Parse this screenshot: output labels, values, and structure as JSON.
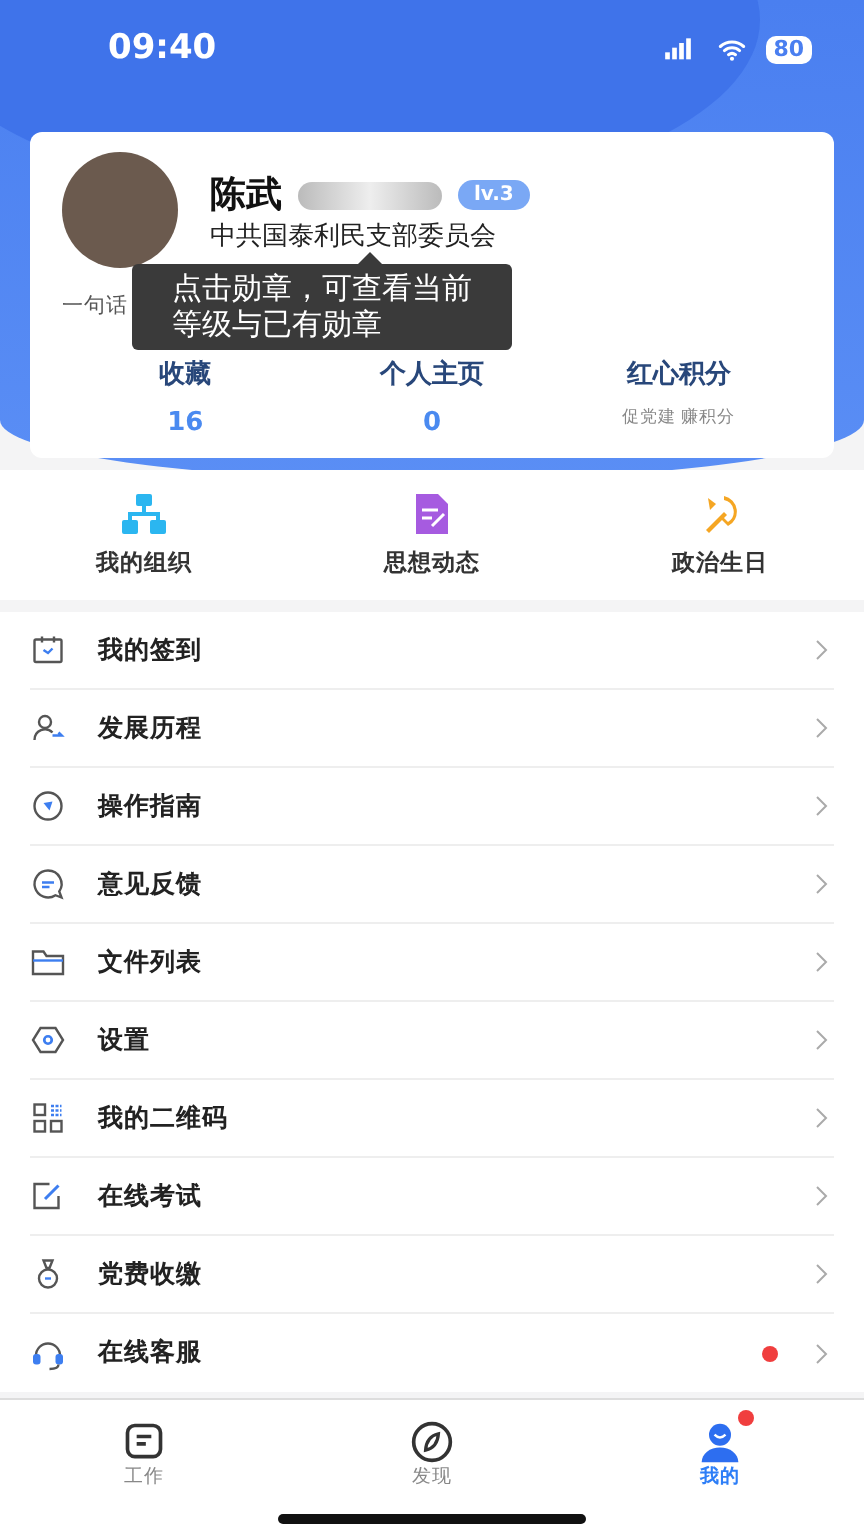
{
  "status_bar": {
    "time": "09:40",
    "battery": "80"
  },
  "profile": {
    "name": "陈武",
    "level": "lv.3",
    "organization": "中共国泰利民支部委员会",
    "signature": "一句话"
  },
  "tooltip": {
    "text": "点击勋章，可查看当前等级与已有勋章"
  },
  "stats": [
    {
      "kind": "count",
      "label": "收藏",
      "value": "16"
    },
    {
      "kind": "count",
      "label": "个人主页",
      "value": "0"
    },
    {
      "kind": "note",
      "label": "红心积分",
      "value": "促党建 赚积分"
    }
  ],
  "shortcuts": [
    {
      "kind": "org",
      "label": "我的组织"
    },
    {
      "kind": "thought",
      "label": "思想动态"
    },
    {
      "kind": "party",
      "label": "政治生日"
    }
  ],
  "menu": [
    {
      "kind": "calendar",
      "label": "我的签到",
      "unread": false
    },
    {
      "kind": "person",
      "label": "发展历程",
      "unread": false
    },
    {
      "kind": "compass",
      "label": "操作指南",
      "unread": false
    },
    {
      "kind": "chat",
      "label": "意见反馈",
      "unread": false
    },
    {
      "kind": "folder",
      "label": "文件列表",
      "unread": false
    },
    {
      "kind": "settings",
      "label": "设置",
      "unread": false
    },
    {
      "kind": "qr",
      "label": "我的二维码",
      "unread": false
    },
    {
      "kind": "exam",
      "label": "在线考试",
      "unread": false
    },
    {
      "kind": "fee",
      "label": "党费收缴",
      "unread": false
    },
    {
      "kind": "headset",
      "label": "在线客服",
      "unread": true
    }
  ],
  "tabs": [
    {
      "kind": "work",
      "label": "工作",
      "selected": false,
      "unread": false
    },
    {
      "kind": "discover",
      "label": "发现",
      "selected": false,
      "unread": false
    },
    {
      "kind": "me",
      "label": "我的",
      "selected": true,
      "unread": true
    }
  ]
}
